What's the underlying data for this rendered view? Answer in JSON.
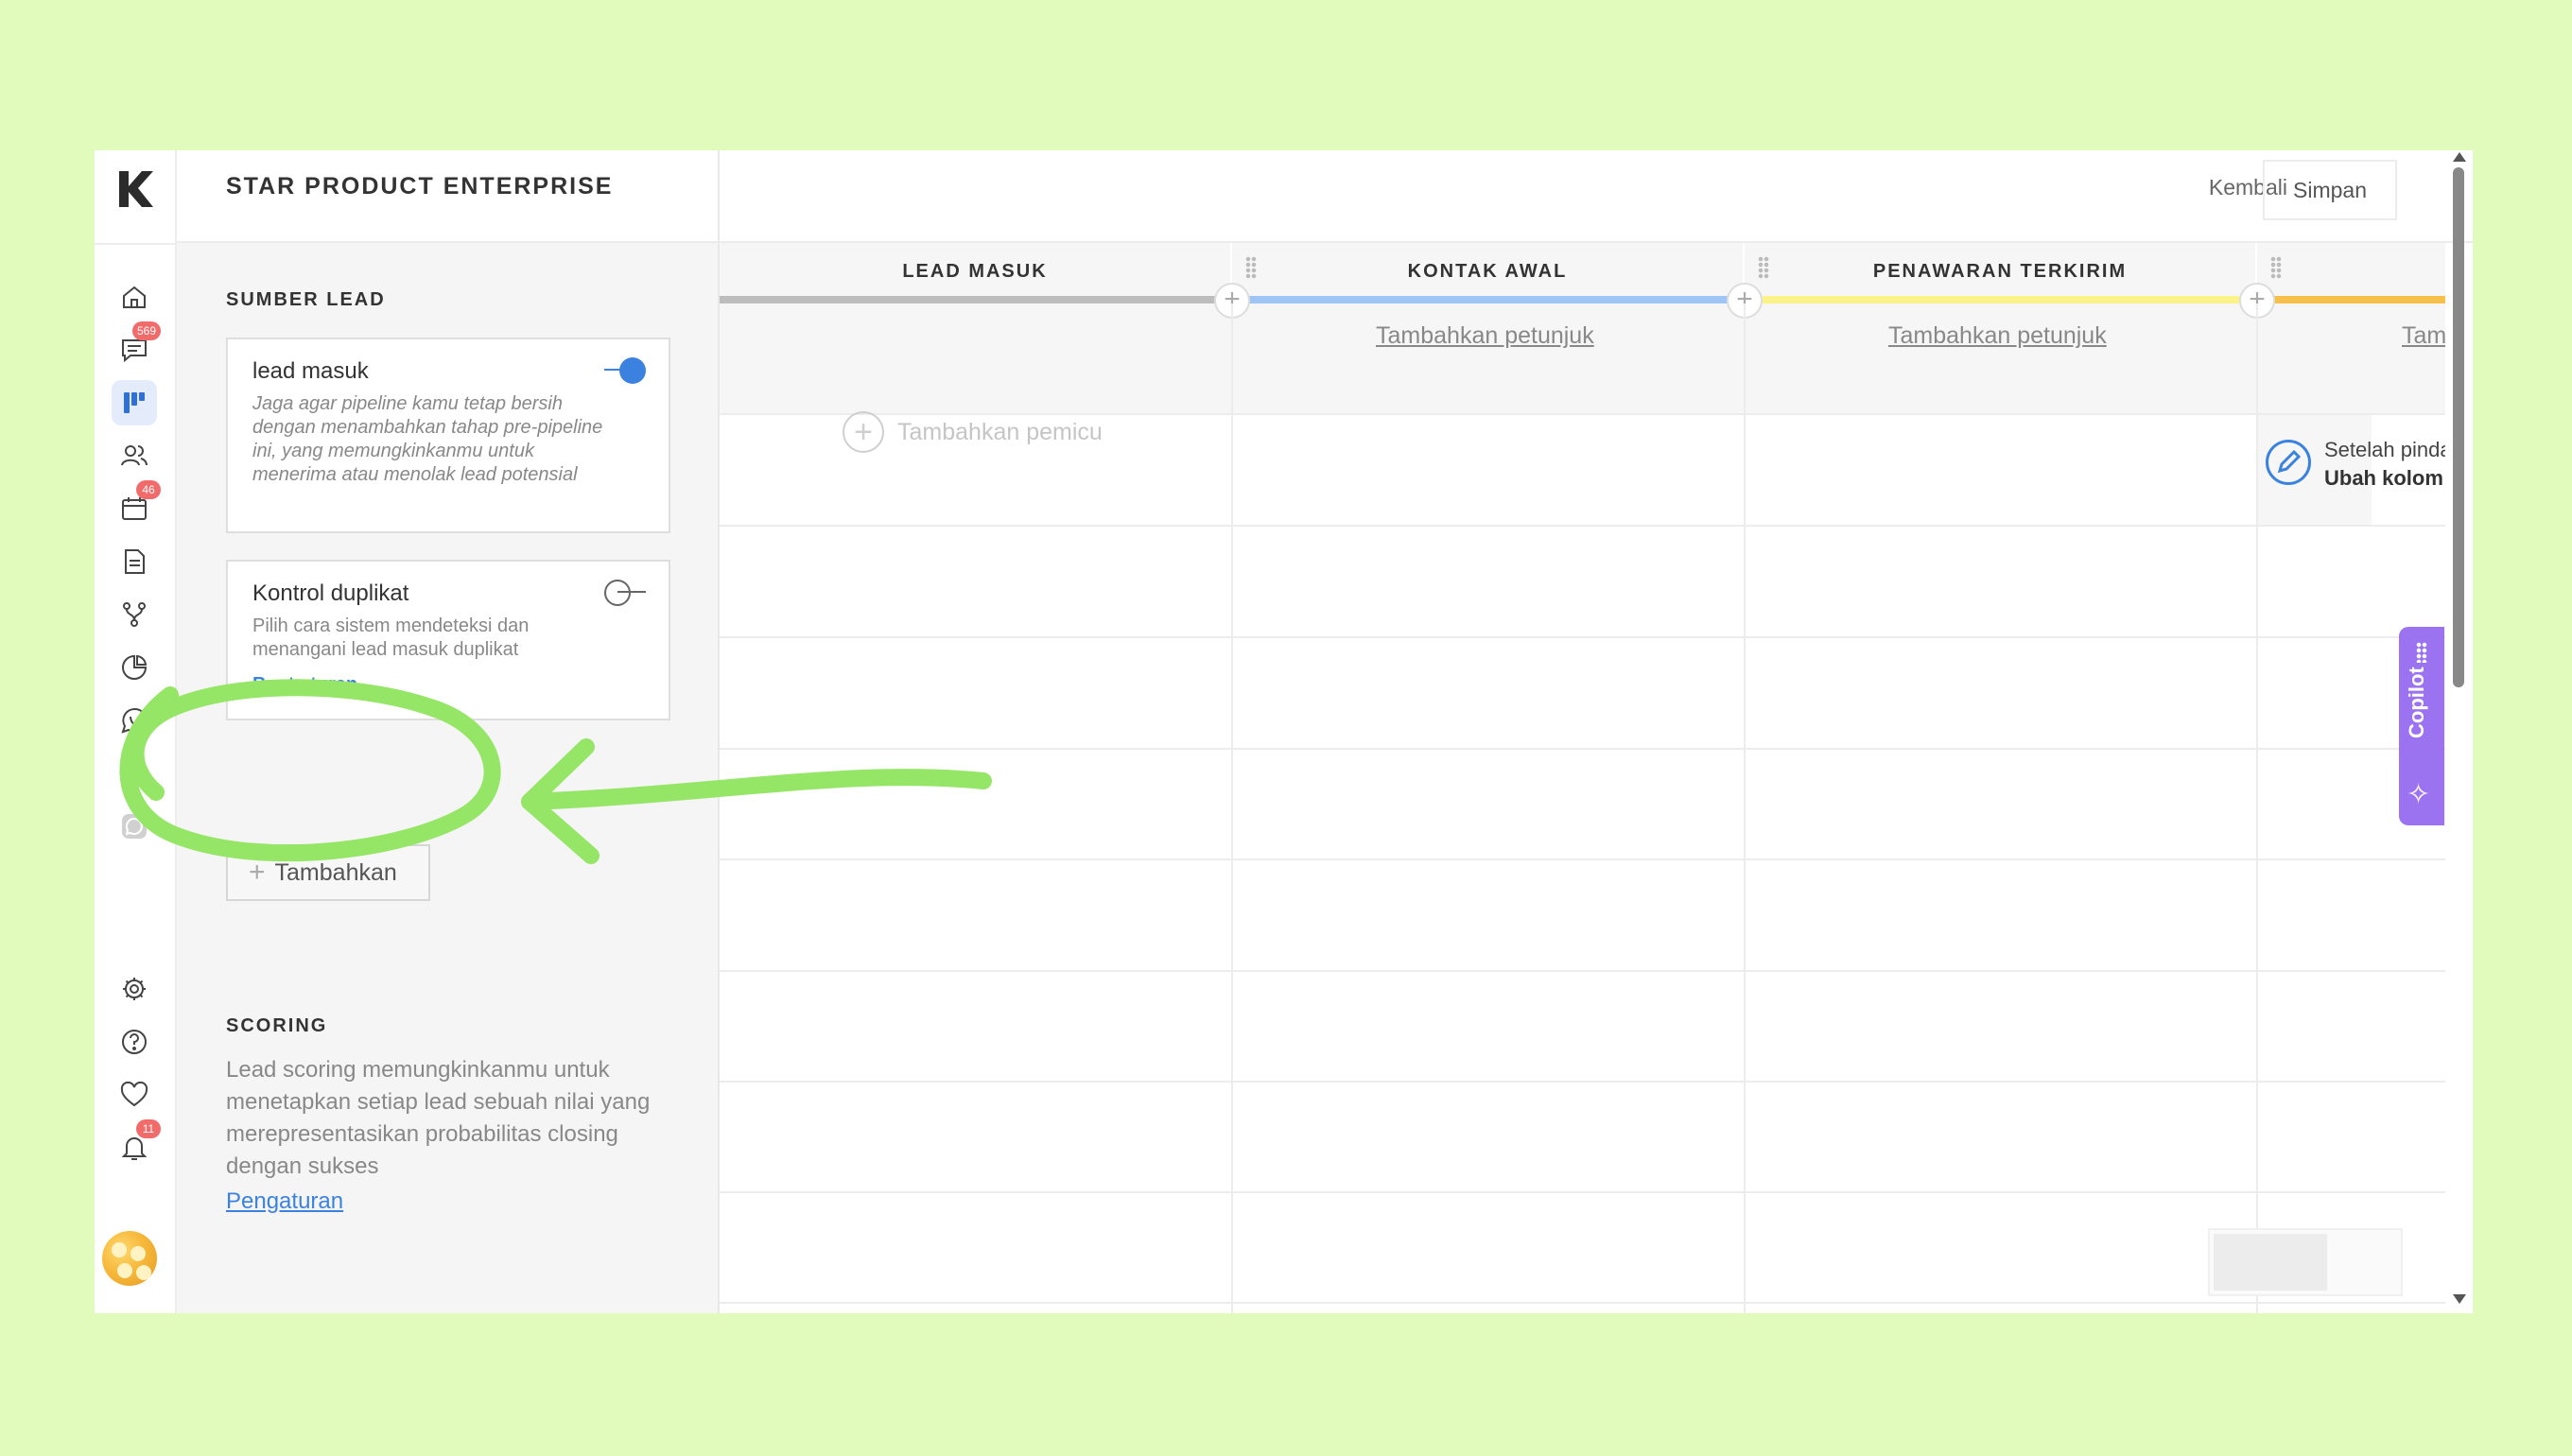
{
  "app": {
    "title": "STAR PRODUCT ENTERPRISE",
    "back_label": "Kembali",
    "save_label": "Simpan"
  },
  "rail": {
    "badges": {
      "messages": "569",
      "calendar": "46",
      "notifications": "11"
    },
    "icons": [
      "home-icon",
      "chat-icon",
      "pipeline-icon",
      "contacts-icon",
      "calendar-icon",
      "document-icon",
      "flow-icon",
      "report-icon",
      "whatsapp-icon",
      "whatsapp-alt-icon",
      "settings-icon",
      "help-icon",
      "heart-icon",
      "bell-icon"
    ]
  },
  "lead_source": {
    "section_title": "SUMBER LEAD",
    "cards": [
      {
        "title": "lead masuk",
        "description": "Jaga agar pipeline kamu tetap bersih dengan menambahkan tahap pre-pipeline ini, yang memungkinkanmu untuk menerima atau menolak lead potensial",
        "enabled": true
      },
      {
        "title": "Kontrol duplikat",
        "description": "Pilih cara sistem mendeteksi dan menangani lead masuk duplikat",
        "link": "Buat aturan",
        "enabled": false
      }
    ],
    "add_label": "Tambahkan"
  },
  "scoring": {
    "section_title": "SCORING",
    "description": "Lead scoring memungkinkanmu untuk menetapkan setiap lead sebuah nilai yang merepresentasikan probabilitas closing dengan sukses",
    "link": "Pengaturan"
  },
  "pipeline": {
    "stages": [
      {
        "name": "LEAD MASUK",
        "color": "#bdbdbd",
        "hint": ""
      },
      {
        "name": "KONTAK AWAL",
        "color": "#9ec5f5",
        "hint": "Tambahkan petunjuk"
      },
      {
        "name": "PENAWARAN TERKIRIM",
        "color": "#fbf28a",
        "hint": "Tambahkan petunjuk"
      },
      {
        "name": "",
        "color": "#f7c04a",
        "hint": "Tam"
      }
    ],
    "add_trigger_label": "Tambahkan pemicu",
    "trigger": {
      "line1": "Setelah pinda",
      "line2": "Ubah kolom"
    }
  },
  "copilot": {
    "label": "Copilot"
  },
  "colors": {
    "accent": "#3b82e0",
    "annotation": "#95e567",
    "copilot": "#9b72f0",
    "badge": "#f26b6b"
  }
}
